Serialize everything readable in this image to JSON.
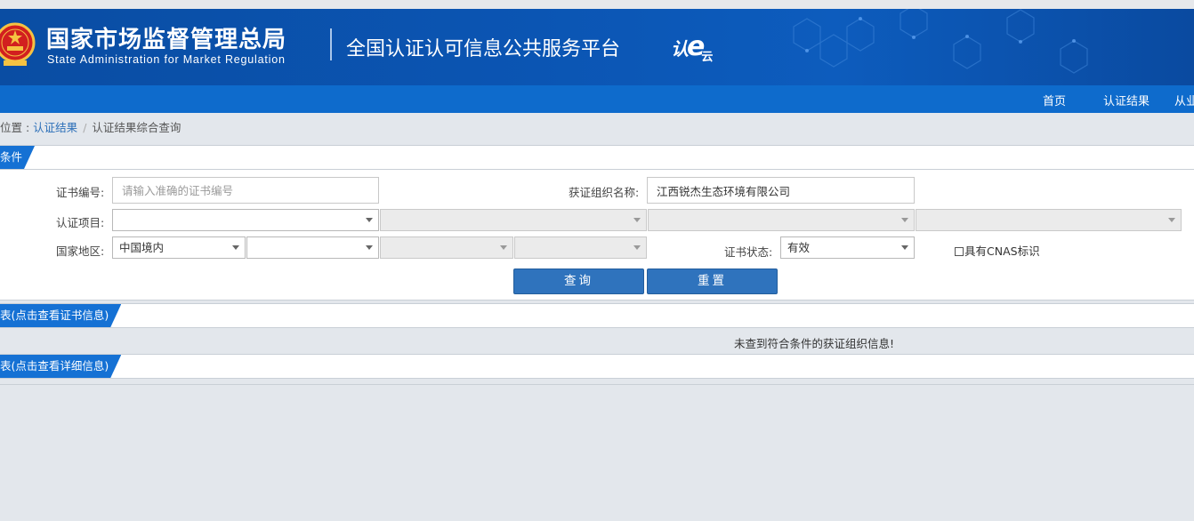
{
  "header": {
    "agency_cn": "国家市场监督管理总局",
    "agency_en": "State Administration  for  Market Regulation",
    "platform_title": "全国认证认可信息公共服务平台",
    "logo_text_a": "认",
    "logo_text_b": "e",
    "logo_text_c": "云"
  },
  "nav": {
    "items": [
      {
        "label": "首页"
      },
      {
        "label": "认证结果"
      },
      {
        "label": "从业"
      }
    ]
  },
  "breadcrumb": {
    "prefix": "位置 : ",
    "link": "认证结果",
    "separator": "/",
    "current": "认证结果综合查询"
  },
  "search_panel": {
    "title": "条件",
    "cert_no_label": "证书编号:",
    "cert_no_placeholder": "请输入准确的证书编号",
    "cert_no_value": "",
    "org_name_label": "获证组织名称:",
    "org_name_value": "江西锐杰生态环境有限公司",
    "project_label": "认证项目:",
    "project_selects": [
      "",
      "",
      "",
      ""
    ],
    "region_label": "国家地区:",
    "region_selects": [
      "中国境内",
      "",
      "",
      ""
    ],
    "status_label": "证书状态:",
    "status_value": "有效",
    "cnas_label": "具有CNAS标识",
    "search_button": "查询",
    "reset_button": "重置"
  },
  "results_panel": {
    "title": "表(点击查看证书信息)",
    "empty_message": "未查到符合条件的获证组织信息!"
  },
  "detail_panel": {
    "title": "表(点击查看详细信息)"
  },
  "colors": {
    "banner": "#0b55b3",
    "navbar": "#0e6bcc",
    "tab": "#1571d4",
    "button": "#2f73bd",
    "page_bg": "#e3e7ec"
  }
}
